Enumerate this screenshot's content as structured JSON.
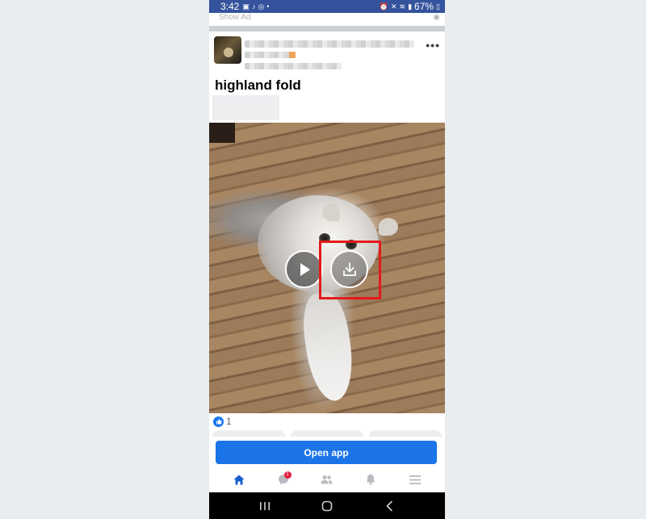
{
  "status_bar": {
    "time": "3:42",
    "battery": "67%"
  },
  "ad_strip": {
    "label": "Show Ad"
  },
  "post": {
    "title": "highland fold",
    "reaction_count": "1"
  },
  "cta": {
    "open_app_label": "Open app"
  },
  "tab_bar": {
    "messenger_badge": "1",
    "icons": [
      "home-icon",
      "messenger-icon",
      "friends-icon",
      "notifications-icon",
      "menu-icon"
    ]
  },
  "colors": {
    "status_bar": "#34539c",
    "primary_button": "#1b74e8",
    "highlight": "#e3191b",
    "like": "#1877f2",
    "badge": "#e41e3f"
  }
}
